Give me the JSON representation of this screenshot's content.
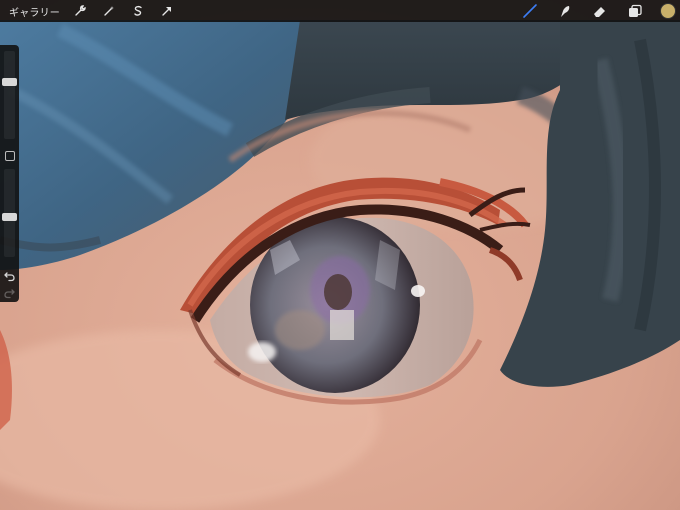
{
  "topbar": {
    "gallery_label": "ギャラリー",
    "left_icons": [
      "wrench-icon",
      "magic-wand-icon",
      "selection-s-icon",
      "transform-arrow-icon"
    ],
    "right_icons": [
      "brush-icon",
      "smudge-icon",
      "eraser-icon",
      "layers-icon"
    ],
    "active_tool": "brush",
    "active_tool_color": "#3d7df5",
    "current_color": "#c9b06a"
  },
  "sidebar": {
    "size_slider_value": 0.34,
    "opacity_slider_value": 0.55,
    "icons": [
      "modify-square-icon",
      "undo-icon",
      "redo-icon"
    ]
  }
}
